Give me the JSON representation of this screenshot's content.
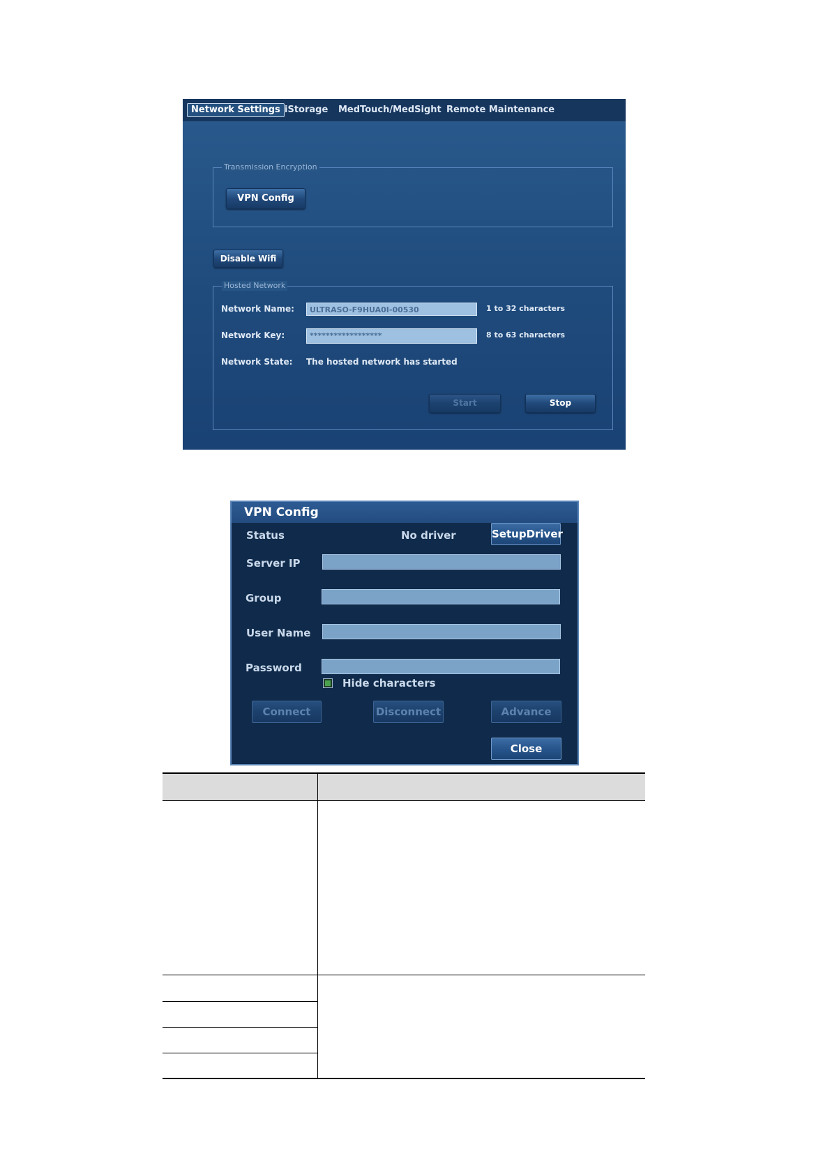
{
  "network_settings": {
    "tabs": [
      {
        "label": "Network Settings",
        "active": true
      },
      {
        "label": "iStorage",
        "active": false
      },
      {
        "label": "MedTouch/MedSight",
        "active": false
      },
      {
        "label": "Remote Maintenance",
        "active": false
      }
    ],
    "transmission_encryption": {
      "legend": "Transmission Encryption",
      "vpn_config_button": "VPN Config"
    },
    "disable_wifi_button": "Disable Wifi",
    "hosted_network": {
      "legend": "Hosted Network",
      "network_name_label": "Network Name:",
      "network_name_value": "ULTRASO-F9HUA0I-00530",
      "network_name_hint": "1 to 32 characters",
      "network_key_label": "Network Key:",
      "network_key_value": "******************",
      "network_key_hint": "8 to 63 characters",
      "network_state_label": "Network State:",
      "network_state_value": "The hosted network has started",
      "start_button": "Start",
      "stop_button": "Stop"
    }
  },
  "vpn_config": {
    "title": "VPN Config",
    "status_label": "Status",
    "status_value": "No driver",
    "setup_driver_button": "SetupDriver",
    "server_ip_label": "Server IP",
    "group_label": "Group",
    "user_name_label": "User Name",
    "password_label": "Password",
    "hide_characters_label": "Hide characters",
    "hide_characters_checked": true,
    "connect_button": "Connect",
    "disconnect_button": "Disconnect",
    "advance_button": "Advance",
    "close_button": "Close"
  },
  "colors": {
    "panel_blue": "#1f4b7c",
    "dialog_navy": "#0f2a4a",
    "field_blue": "#9ec1e2",
    "check_green": "#4aa24e"
  }
}
